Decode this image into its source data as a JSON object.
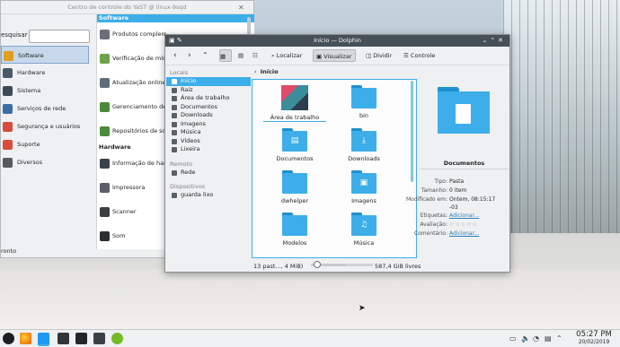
{
  "yast": {
    "title": "Centro de controle do YaST @ linux-9sqd",
    "search_label": "esquisar",
    "search_value": "",
    "categories": [
      {
        "label": "Software",
        "icon": "software-icon",
        "color": "#e0a020"
      },
      {
        "label": "Hardware",
        "icon": "hardware-icon",
        "color": "#4a5a6a"
      },
      {
        "label": "Sistema",
        "icon": "system-icon",
        "color": "#3b4a58"
      },
      {
        "label": "Serviços de rede",
        "icon": "network-services-icon",
        "color": "#3a6ea5"
      },
      {
        "label": "Segurança e usuários",
        "icon": "security-icon",
        "color": "#d84a3a"
      },
      {
        "label": "Suporte",
        "icon": "support-icon",
        "color": "#d94b3b"
      },
      {
        "label": "Diversos",
        "icon": "misc-icon",
        "color": "#555b60"
      }
    ],
    "software_header": "Software",
    "software_modules": [
      {
        "label": "Produtos complem",
        "icon": "cd-icon",
        "color": "#6a7075"
      },
      {
        "label": "Verificação de míd",
        "icon": "media-check-icon",
        "color": "#6ca34a"
      },
      {
        "label": "Atualização online",
        "icon": "online-update-icon",
        "color": "#5d6e7a"
      },
      {
        "label": "Gerenciamento de",
        "icon": "software-management-icon",
        "color": "#4a8a3a"
      },
      {
        "label": "Repositórios de so",
        "icon": "repositories-icon",
        "color": "#4a8a3a"
      }
    ],
    "hardware_header": "Hardware",
    "hardware_modules": [
      {
        "label": "Informação de har",
        "icon": "hardware-info-icon",
        "color": "#3c4348"
      },
      {
        "label": "Impressora",
        "icon": "printer-icon",
        "color": "#5a6066"
      },
      {
        "label": "Scanner",
        "icon": "scanner-icon",
        "color": "#3a3f44"
      },
      {
        "label": "Som",
        "icon": "sound-icon",
        "color": "#2a2f33"
      }
    ],
    "status": "ronto"
  },
  "dolphin": {
    "title": "Início — Dolphin",
    "toolbar": {
      "localizar": "Localizar",
      "visualizar": "Visualizar",
      "dividir": "Dividir",
      "controle": "Controle"
    },
    "sidebar": {
      "locais_header": "Locais",
      "locais": [
        "Início",
        "Raiz",
        "Área de trabalho",
        "Documentos",
        "Downloads",
        "Imagens",
        "Música",
        "Vídeos",
        "Lixeira"
      ],
      "remoto_header": "Remoto",
      "remoto": [
        "Rede"
      ],
      "dispositivos_header": "Dispositivos",
      "dispositivos": [
        "guarda lixo"
      ]
    },
    "breadcrumb": "Início",
    "items": [
      {
        "label": "Área de trabalho",
        "kind": "desktop"
      },
      {
        "label": "bin",
        "kind": "folder",
        "symbol": ""
      },
      {
        "label": "Documentos",
        "kind": "folder",
        "symbol": "▤"
      },
      {
        "label": "Downloads",
        "kind": "folder",
        "symbol": "⤓"
      },
      {
        "label": "dwhelper",
        "kind": "folder",
        "symbol": ""
      },
      {
        "label": "Imagens",
        "kind": "folder",
        "symbol": "▣"
      },
      {
        "label": "Modelos",
        "kind": "folder",
        "symbol": ""
      },
      {
        "label": "Música",
        "kind": "folder",
        "symbol": "♫"
      }
    ],
    "info": {
      "name": "Documentos",
      "rows": [
        {
          "k": "Tipo:",
          "v": "Pasta",
          "link": false
        },
        {
          "k": "Tamanho:",
          "v": "0 item",
          "link": false
        },
        {
          "k": "Modificado em:",
          "v": "Ontem, 08:15:17",
          "link": false
        },
        {
          "k": "",
          "v": "-03",
          "link": false
        },
        {
          "k": "Etiquetas:",
          "v": "Adicionar...",
          "link": true
        },
        {
          "k": "Avaliação:",
          "v": "☆☆☆☆☆",
          "link": false
        },
        {
          "k": "Comentário:",
          "v": "Adicionar...",
          "link": true
        }
      ]
    },
    "status_left": "13 past..., 4 MiB)",
    "zoom": 0.1,
    "status_right": "587,4 GiB livres"
  },
  "taskbar": {
    "time": "05:27 PM",
    "date": "20/02/2019"
  }
}
